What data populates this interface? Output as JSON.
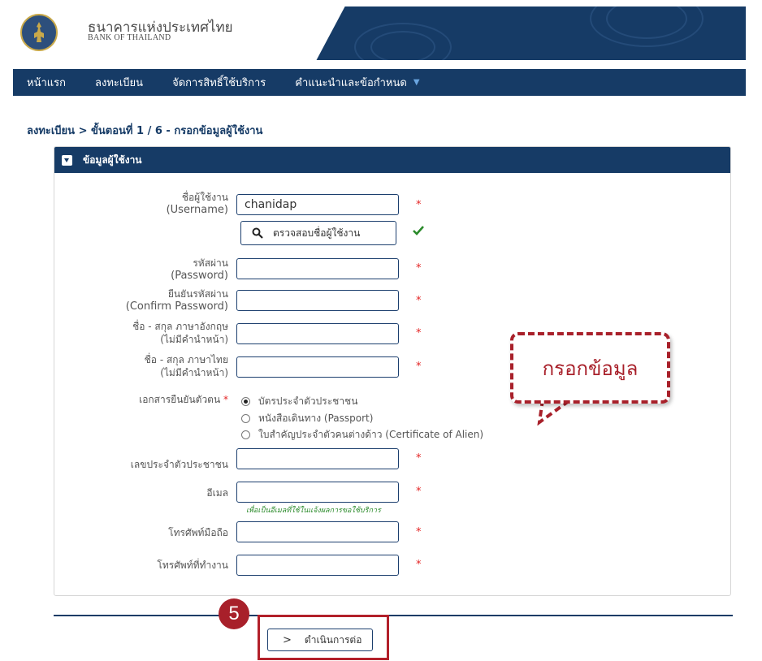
{
  "header": {
    "bank_name_th": "ธนาคารแห่งประเทศไทย",
    "bank_name_en": "BANK OF THAILAND",
    "logo_icon": "bank-seal-icon"
  },
  "nav": {
    "items": [
      {
        "label": "หน้าแรก"
      },
      {
        "label": "ลงทะเบียน"
      },
      {
        "label": "จัดการสิทธิ์ใช้บริการ"
      },
      {
        "label": "คำแนะนำและข้อกำหนด"
      }
    ],
    "caret": "▼"
  },
  "breadcrumb": "ลงทะเบียน > ขั้นตอนที่ 1 / 6 - กรอกข้อมูลผู้ใช้งาน",
  "panel": {
    "title": "ข้อมูลผู้ใช้งาน",
    "required_mark": "*",
    "username": {
      "label_th": "ชื่อผู้ใช้งาน",
      "label_en": "(Username)",
      "value": "chanidap"
    },
    "check_button": {
      "label": "ตรวจสอบชื่อผู้ใช้งาน",
      "icon": "search-icon",
      "status_icon": "checkmark-icon"
    },
    "password": {
      "label_th": "รหัสผ่าน",
      "label_en": "(Password)",
      "value": ""
    },
    "confirm_password": {
      "label_th": "ยืนยันรหัสผ่าน",
      "label_en": "(Confirm Password)",
      "value": ""
    },
    "name_en": {
      "label_th": "ชื่อ - สกุล ภาษาอังกฤษ",
      "label_sub": "(ไม่มีคำนำหน้า)",
      "value": ""
    },
    "name_th": {
      "label_th": "ชื่อ - สกุล ภาษาไทย",
      "label_sub": "(ไม่มีคำนำหน้า)",
      "value": ""
    },
    "id_document": {
      "label": "เอกสารยืนยันตัวตน",
      "options": [
        {
          "label": "บัตรประจำตัวประชาชน",
          "selected": true
        },
        {
          "label": "หนังสือเดินทาง (Passport)",
          "selected": false
        },
        {
          "label": "ใบสำคัญประจำตัวคนต่างด้าว (Certificate of Alien)",
          "selected": false
        }
      ]
    },
    "citizen_id": {
      "label": "เลขประจำตัวประชาชน",
      "value": ""
    },
    "email": {
      "label": "อีเมล",
      "value": "",
      "hint": "เพื่อเป็นอีเมลที่ใช้ในแจ้งผลการขอใช้บริการ"
    },
    "mobile_phone": {
      "label": "โทรศัพท์มือถือ",
      "value": ""
    },
    "office_phone": {
      "label": "โทรศัพท์ที่ทำงาน",
      "value": ""
    }
  },
  "callout": {
    "text": "กรอกข้อมูล",
    "color": "#a8202a"
  },
  "step_badge": "5",
  "next_button": {
    "label": "ดำเนินการต่อ",
    "icon": "chevron-right-icon"
  },
  "colors": {
    "primary": "#163b66",
    "required": "#e32424",
    "success": "#2a8a2a",
    "annotation": "#a8202a"
  }
}
